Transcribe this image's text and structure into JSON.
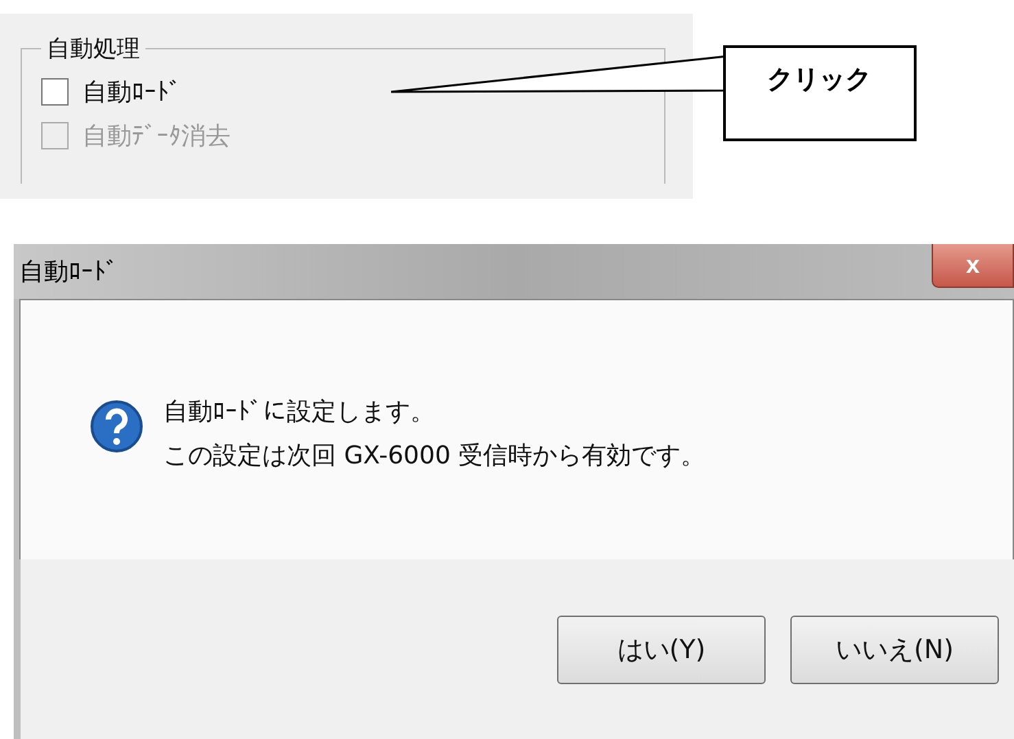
{
  "group": {
    "title": "自動処理",
    "options": [
      {
        "label": "自動ﾛｰﾄﾞ",
        "checked": false,
        "disabled": false
      },
      {
        "label": "自動ﾃﾞｰﾀ消去",
        "checked": false,
        "disabled": true
      }
    ]
  },
  "callout": {
    "text": "クリック"
  },
  "dialog": {
    "title": "自動ﾛｰﾄﾞ",
    "close": "x",
    "message": [
      "自動ﾛｰﾄﾞに設定します。",
      "この設定は次回 GX-6000 受信時から有効です。"
    ],
    "buttons": [
      {
        "label": "はい(Y)",
        "selected": false
      },
      {
        "label": "いいえ(N)",
        "selected": false
      }
    ]
  }
}
